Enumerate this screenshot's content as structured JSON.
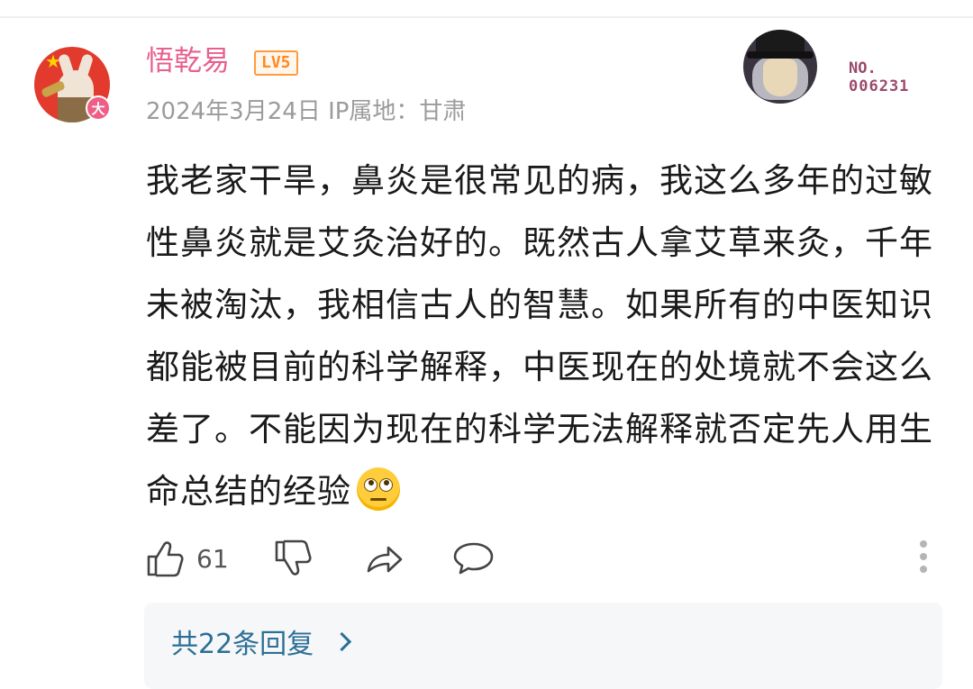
{
  "comment": {
    "username": "悟乾易",
    "level": "LV5",
    "avatar_badge": "大",
    "date": "2024年3月24日",
    "ip_location": "IP属地：甘肃",
    "decoration": {
      "label": "NO.",
      "number": "006231"
    },
    "body": "我老家干旱，鼻炎是很常见的病，我这么多年的过敏性鼻炎就是艾灸治好的。既然古人拿艾草来灸，千年未被淘汰，我相信古人的智慧。如果所有的中医知识都能被目前的科学解释，中医现在的处境就不会这么差了。不能因为现在的科学无法解释就否定先人用生命总结的经验",
    "emoji": "face-with-rolling-eyes",
    "likes": "61",
    "replies_link": "共22条回复"
  },
  "icons": [
    "like-icon",
    "dislike-icon",
    "share-icon",
    "comment-icon",
    "more-icon",
    "chevron-right-icon"
  ],
  "colors": {
    "username": "#e8608e",
    "level": "#ff8a1f",
    "reply_link": "#2b6f96",
    "meta": "#9b9b9b"
  }
}
